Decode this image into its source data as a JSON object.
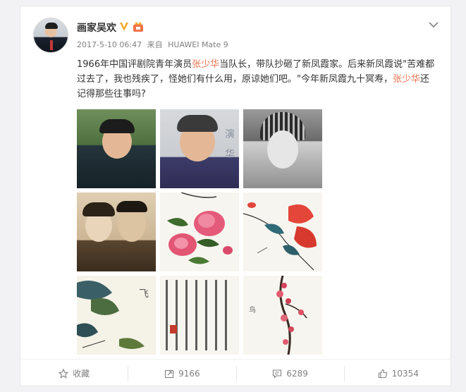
{
  "post": {
    "author": "画家吴欢",
    "timestamp": "2017-5-10 06:47",
    "source_prefix": "来自",
    "source_device": "HUAWEI Mate 9",
    "text_1": "1966年中国评剧院青年演员",
    "name_highlight": "张少华",
    "text_2": "当队长，带队抄砸了新凤霞家。后来新凤霞说\"苦难都过去了，我也残疾了，怪她们有什么用，原谅她们吧。\"今年新凤霞九十冥寿，",
    "text_3": "还记得那些往事吗?",
    "highlight_color": "#eb7350",
    "photo_caption_text": "演\n华",
    "painting_text_1": "飞",
    "painting_text_2": "鸟"
  },
  "actions": {
    "favorite_label": "收藏",
    "repost_count": "9166",
    "comment_count": "6289",
    "like_count": "10354"
  },
  "icons": {
    "vip": "vip-v-icon",
    "badge": "member-badge-icon",
    "more": "chevron-down-icon",
    "favorite": "star-icon",
    "repost": "repost-icon",
    "comment": "comment-icon",
    "like": "thumbs-up-icon"
  },
  "colors": {
    "vip_gold": "#f5a623",
    "text_gray": "#808080"
  }
}
